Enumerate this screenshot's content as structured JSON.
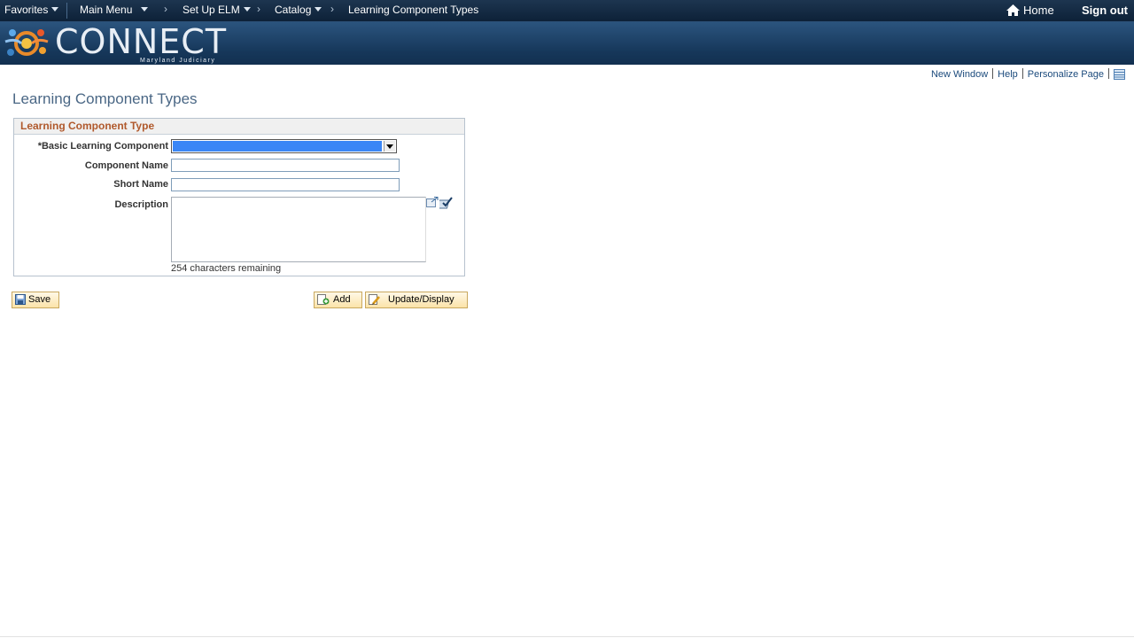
{
  "nav": {
    "favorites": "Favorites",
    "main_menu": "Main Menu",
    "setup_elm": "Set Up ELM",
    "catalog": "Catalog",
    "current": "Learning Component Types",
    "home": "Home",
    "signout": "Sign out"
  },
  "brand": {
    "name": "CONNECT",
    "subtitle": "Maryland Judiciary"
  },
  "pagelinks": {
    "new_window": "New Window",
    "help": "Help",
    "personalize": "Personalize Page"
  },
  "page": {
    "title": "Learning Component Types"
  },
  "group": {
    "header": "Learning Component Type",
    "basic_label": "*Basic Learning Component",
    "basic_value": "",
    "component_name_label": "Component Name",
    "component_name_value": "",
    "short_name_label": "Short Name",
    "short_name_value": "",
    "description_label": "Description",
    "description_value": "",
    "chars_remaining": "254 characters remaining"
  },
  "buttons": {
    "save": "Save",
    "add": "Add",
    "update": "Update/Display"
  },
  "colors": {
    "nav_bg": "#0d2138",
    "banner_bg": "#1f4670",
    "group_header": "#b0592c",
    "title": "#4a6785",
    "link": "#1b4a7c"
  }
}
